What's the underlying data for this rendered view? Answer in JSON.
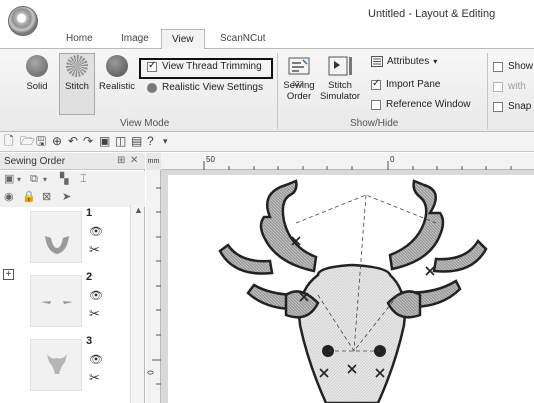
{
  "window": {
    "title": "Untitled - Layout & Editing"
  },
  "tabs": [
    "Home",
    "Image",
    "View",
    "ScanNCut"
  ],
  "active_tab": "View",
  "ribbon": {
    "view_mode": {
      "label": "View Mode",
      "solid": "Solid",
      "stitch": "Stitch",
      "realistic": "Realistic",
      "view_thread_trimming": "View Thread Trimming",
      "realistic_view_settings": "Realistic View Settings"
    },
    "show_hide": {
      "label": "Show/Hide",
      "sewing_order_1": "Sewing",
      "sewing_order_2": "Order",
      "stitch_sim_1": "Stitch",
      "stitch_sim_2": "Simulator",
      "attributes": "Attributes",
      "import_pane": "Import Pane",
      "reference_window": "Reference Window",
      "sim_badge": "123"
    },
    "partial": {
      "show": "Show",
      "with": "with",
      "snap": "Snap"
    }
  },
  "sewing_order": {
    "title": "Sewing Order",
    "items": [
      {
        "num": "1"
      },
      {
        "num": "2"
      },
      {
        "num": "3"
      }
    ]
  },
  "ruler": {
    "unit": "mm",
    "label_50": "50",
    "label_0": "0",
    "left_0": "0"
  },
  "colors": {
    "highlight": "#111111",
    "accent": "#2d6db5"
  }
}
